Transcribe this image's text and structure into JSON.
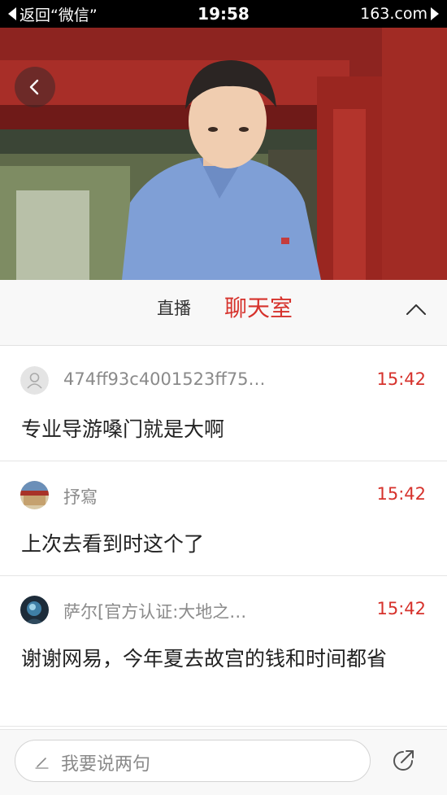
{
  "status_bar": {
    "back_text": "返回“微信”",
    "time": "19:58",
    "site": "163.com"
  },
  "tabs": {
    "live": "直播",
    "chat": "聊天室"
  },
  "messages": [
    {
      "username": "474ff93c4001523ff75…",
      "time": "15:42",
      "text": "专业导游嗓门就是大啊"
    },
    {
      "username": "抒寫",
      "time": "15:42",
      "text": "上次去看到时这个了"
    },
    {
      "username": "萨尔[官方认证:大地之…",
      "time": "15:42",
      "text": "谢谢网易，今年夏去故宫的钱和时间都省"
    }
  ],
  "input": {
    "placeholder": "我要说两句"
  },
  "colors": {
    "accent": "#d6322c",
    "muted": "#8a8a8a"
  },
  "icons": [
    "back-arrow-icon",
    "chevron-up-icon",
    "user-icon",
    "pencil-icon",
    "share-icon"
  ]
}
